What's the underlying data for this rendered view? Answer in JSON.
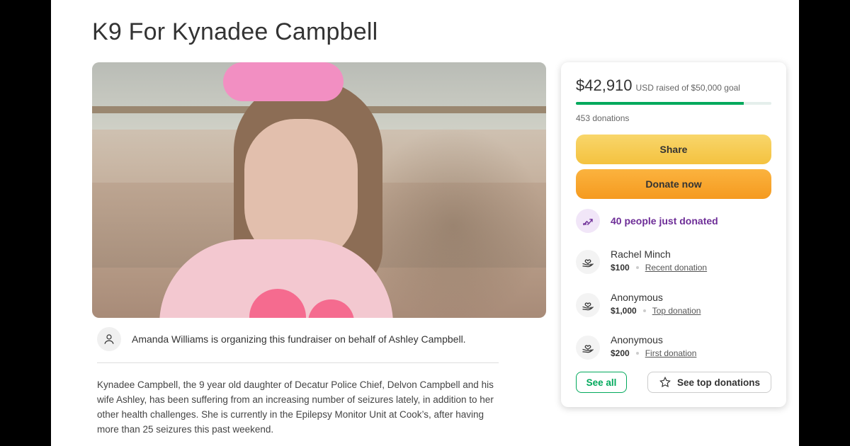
{
  "campaign": {
    "title": "K9 For Kynadee Campbell",
    "organizer_text": "Amanda Williams is organizing this fundraiser on behalf of Ashley Campbell.",
    "story": "Kynadee Campbell, the 9 year old daughter of Decatur Police Chief, Delvon Campbell and his wife Ashley, has been suffering from an increasing number of seizures lately, in addition to her other health challenges. She is currently in the Epilepsy Monitor Unit at Cook’s, after having more than 25 seizures this past weekend."
  },
  "card": {
    "raised_amount": "$42,910",
    "raised_label": "USD raised of $50,000 goal",
    "progress_fraction": 0.858,
    "donation_count": "453 donations",
    "share_label": "Share",
    "donate_label": "Donate now",
    "trend_text": "40 people just donated",
    "donors": [
      {
        "name": "Rachel Minch",
        "amount": "$100",
        "tag": "Recent donation"
      },
      {
        "name": "Anonymous",
        "amount": "$1,000",
        "tag": "Top donation"
      },
      {
        "name": "Anonymous",
        "amount": "$200",
        "tag": "First donation"
      }
    ],
    "see_all_label": "See all",
    "see_top_label": "See top donations"
  },
  "colors": {
    "accent_green": "#02a95c",
    "share_yellow": "#f4c23f",
    "donate_orange": "#f59a1f",
    "trend_purple": "#6d2d97"
  },
  "icons": {
    "organizer": "user-icon",
    "trend": "trending-up-icon",
    "donor": "donation-heart-hand-icon",
    "top": "star-icon"
  }
}
